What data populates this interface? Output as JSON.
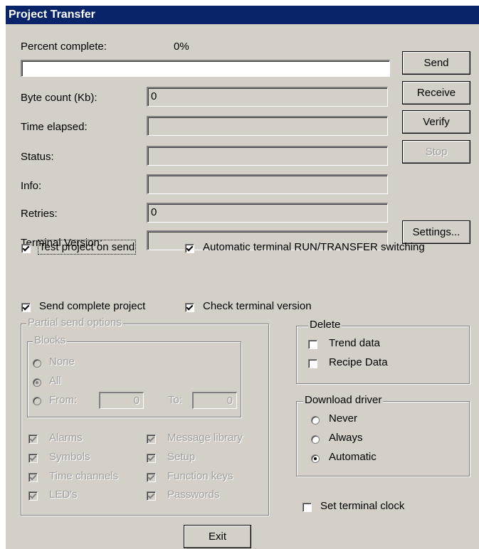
{
  "window": {
    "title": "Project Transfer"
  },
  "progress": {
    "label": "Percent complete:",
    "value_text": "0%",
    "fraction": 0
  },
  "fields": {
    "byte_count": {
      "label": "Byte count (Kb):",
      "value": "0"
    },
    "time_elapsed": {
      "label": "Time elapsed:",
      "value": ""
    },
    "status": {
      "label": "Status:",
      "value": ""
    },
    "info": {
      "label": "Info:",
      "value": ""
    },
    "retries": {
      "label": "Retries:",
      "value": "0"
    },
    "terminal_version": {
      "label": "Terminal Version:",
      "value": ""
    }
  },
  "buttons": {
    "send": "Send",
    "receive": "Receive",
    "verify": "Verify",
    "stop": "Stop",
    "settings": "Settings...",
    "exit": "Exit"
  },
  "options": {
    "test_project": {
      "label": "Test project on send",
      "checked": true
    },
    "auto_switch": {
      "label": "Automatic terminal RUN/TRANSFER switching",
      "checked": true
    },
    "send_complete": {
      "label": "Send complete project",
      "checked": true
    },
    "check_version": {
      "label": "Check terminal version",
      "checked": true
    }
  },
  "partial": {
    "legend": "Partial send options",
    "blocks": {
      "legend": "Blocks",
      "none": "None",
      "all": "All",
      "from": "From:",
      "from_value": "0",
      "to": "To:",
      "to_value": "0",
      "selected": "All"
    },
    "items": {
      "alarms": "Alarms",
      "symbols": "Symbols",
      "time_channels": "Time channels",
      "leds": "LED's",
      "message_library": "Message library",
      "setup": "Setup",
      "function_keys": "Function keys",
      "passwords": "Passwords"
    }
  },
  "delete": {
    "legend": "Delete",
    "trend_data": {
      "label": "Trend data",
      "checked": false
    },
    "recipe_data": {
      "label": "Recipe Data",
      "checked": false
    }
  },
  "download_driver": {
    "legend": "Download driver",
    "never": "Never",
    "always": "Always",
    "automatic": "Automatic",
    "selected": "Automatic"
  },
  "clock": {
    "label": "Set terminal clock",
    "checked": false
  },
  "colors": {
    "titlebar": "#0a246a",
    "face": "#d4d0c8",
    "disabled_text": "#a0a0a0"
  }
}
